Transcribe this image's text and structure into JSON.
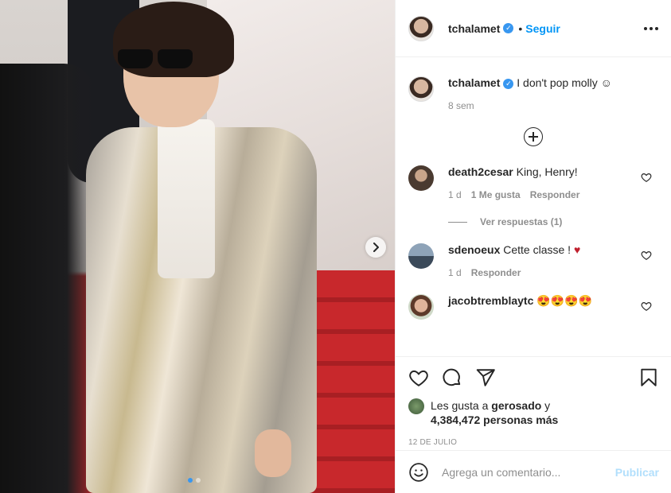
{
  "post": {
    "username": "tchalamet",
    "follow_label": "Seguir",
    "separator": "•",
    "verified_icon": "verified-badge-icon"
  },
  "caption": {
    "username": "tchalamet",
    "text": "I don't pop molly ☺",
    "time": "8 sem"
  },
  "comments": [
    {
      "username": "death2cesar",
      "text": "King, Henry!",
      "time": "1 d",
      "likes": "1 Me gusta",
      "reply_label": "Responder",
      "view_replies": "Ver respuestas (1)"
    },
    {
      "username": "sdenoeux",
      "text": "Cette classe ! ",
      "heart": "♥",
      "time": "1 d",
      "reply_label": "Responder"
    },
    {
      "username": "jacobtremblaytc",
      "text": "😍😍😍😍"
    }
  ],
  "likes": {
    "prefix": "Les gusta a ",
    "user": "gerosado",
    "mid": " y",
    "count": "4,384,472 personas más"
  },
  "date": "12 DE JULIO",
  "add_comment": {
    "placeholder": "Agrega un comentario...",
    "publish_label": "Publicar"
  },
  "carousel": {
    "current": 1,
    "total": 2
  },
  "colors": {
    "accent": "#0095f6",
    "publish_disabled": "#b2dffc",
    "heart_red": "#c0202e"
  }
}
